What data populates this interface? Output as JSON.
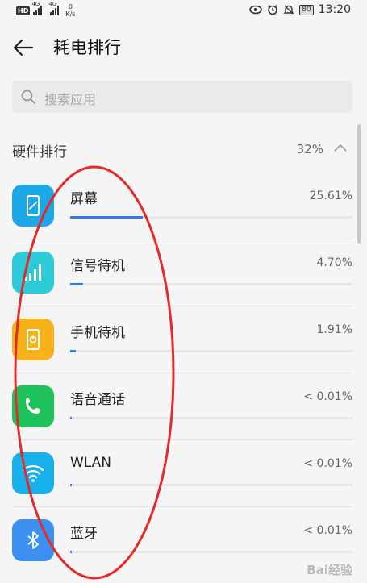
{
  "status_bar": {
    "hd_label": "HD",
    "sim1_label": "4G",
    "sim2_label": "4G",
    "speed_value": "0",
    "speed_unit": "K/s",
    "battery": "80",
    "time": "13:20"
  },
  "header": {
    "title": "耗电排行",
    "back_icon": "arrow-left-icon"
  },
  "search": {
    "placeholder": "搜索应用",
    "icon": "search-icon"
  },
  "section": {
    "title": "硬件排行",
    "percent": "32%",
    "toggle_icon": "chevron-up-icon"
  },
  "items": [
    {
      "name": "屏幕",
      "percent": "25.61%",
      "fraction": 0.256,
      "icon": "screen-icon",
      "icon_color": "#1aa8e8"
    },
    {
      "name": "信号待机",
      "percent": "4.70%",
      "fraction": 0.047,
      "icon": "signal-icon",
      "icon_color": "#2dcad8"
    },
    {
      "name": "手机待机",
      "percent": "1.91%",
      "fraction": 0.019,
      "icon": "phone-standby-icon",
      "icon_color": "#f7b11b"
    },
    {
      "name": "语音通话",
      "percent": "< 0.01%",
      "fraction": 0.0,
      "icon": "phone-call-icon",
      "icon_color": "#1ec25a"
    },
    {
      "name": "WLAN",
      "percent": "< 0.01%",
      "fraction": 0.0,
      "icon": "wifi-icon",
      "icon_color": "#17b2ec"
    },
    {
      "name": "蓝牙",
      "percent": "< 0.01%",
      "fraction": 0.0,
      "icon": "bluetooth-icon",
      "icon_color": "#3d8ff0"
    }
  ],
  "accent_color": "#2f7be8",
  "annotation_color": "#e32b2b",
  "watermark": "Bai经验"
}
